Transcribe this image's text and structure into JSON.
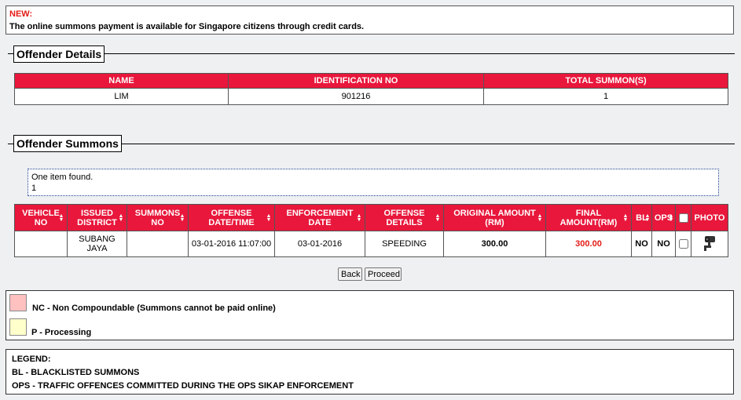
{
  "notice": {
    "title": "NEW:",
    "message": "The online summons payment is available for Singapore citizens through credit cards."
  },
  "offender_details": {
    "section_title": "Offender Details",
    "headers": [
      "NAME",
      "IDENTIFICATION NO",
      "TOTAL SUMMON(S)"
    ],
    "row": {
      "name": "LIM",
      "id": "901216",
      "total": "1"
    }
  },
  "offender_summons": {
    "section_title": "Offender Summons",
    "found_text": "One item found.",
    "page": "1",
    "headers": {
      "vehicle_no": "VEHICLE NO",
      "issued_district": "ISSUED DISTRICT",
      "summons_no": "SUMMONS NO",
      "offense_datetime": "OFFENSE DATE/TIME",
      "enforcement_date": "ENFORCEMENT DATE",
      "offense_details": "OFFENSE DETAILS",
      "original_amount": "ORIGINAL AMOUNT (RM)",
      "final_amount": "FINAL AMOUNT(RM)",
      "bl": "BL",
      "ops": "OPS",
      "photo": "PHOTO"
    },
    "row": {
      "vehicle_no": "",
      "issued_district": "SUBANG JAYA",
      "summons_no": "",
      "offense_datetime": "03-01-2016 11:07:00",
      "enforcement_date": "03-01-2016",
      "offense_details": "SPEEDING",
      "original_amount": "300.00",
      "final_amount": "300.00",
      "bl": "NO",
      "ops": "NO",
      "photo_icon": "camera-icon"
    }
  },
  "buttons": {
    "back": "Back",
    "proceed": "Proceed"
  },
  "status_legend": {
    "nc": {
      "text": "NC - Non Compoundable (Summons cannot be paid online)",
      "color": "#ffc0c0"
    },
    "p": {
      "text": "P - Processing",
      "color": "#ffffcc"
    }
  },
  "legend": {
    "title": "LEGEND:",
    "bl": "BL - BLACKLISTED SUMMONS",
    "ops": "OPS - TRAFFIC OFFENCES COMMITTED DURING THE OPS SIKAP ENFORCEMENT"
  },
  "colors": {
    "header_red": "#e8173b",
    "final_amount": "#e41b17",
    "new_label": "#e41b17"
  }
}
